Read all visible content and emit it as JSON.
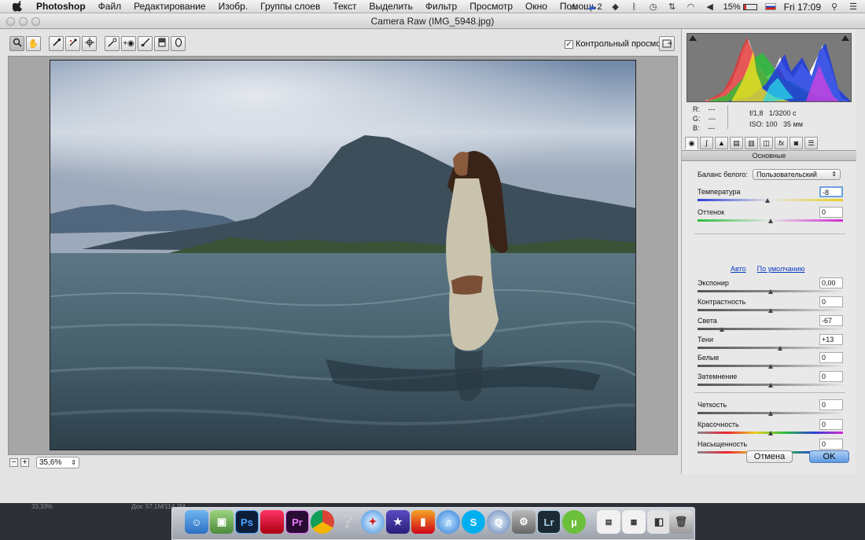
{
  "menubar": {
    "app": "Photoshop",
    "items": [
      "Файл",
      "Редактирование",
      "Изобр.",
      "Группы слоев",
      "Текст",
      "Выделить",
      "Фильтр",
      "Просмотр",
      "Окно",
      "Помощь"
    ],
    "cc_count": "2",
    "battery": "15%",
    "clock": "Fri 17:09"
  },
  "window": {
    "title": "Camera Raw (IMG_5948.jpg)"
  },
  "toolbar": {
    "tools": [
      "zoom-tool",
      "hand-tool",
      "white-balance-tool",
      "color-sampler-tool",
      "target-adjustment-tool",
      "crop-tool",
      "straighten-tool",
      "spot-removal-tool",
      "red-eye-tool",
      "adjustment-brush-tool",
      "graduated-filter-tool",
      "radial-filter-tool"
    ],
    "preview_label": "Контрольный просмотр",
    "preview_checked": true
  },
  "zoom": {
    "value": "35,6%"
  },
  "info": {
    "r_label": "R:",
    "r_value": "---",
    "g_label": "G:",
    "g_value": "---",
    "b_label": "B:",
    "b_value": "---",
    "aperture": "f/1,8",
    "shutter": "1/3200 с",
    "iso": "ISO: 100",
    "focal": "35 мм"
  },
  "panel": {
    "section_title": "Основные",
    "wb_label": "Баланс белого:",
    "wb_value": "Пользовательский",
    "auto_link": "Авто",
    "default_link": "По умолчанию",
    "sliders": [
      {
        "key": "temp",
        "label": "Температура",
        "value": "-8",
        "level": 0.48
      },
      {
        "key": "tint",
        "label": "Оттенок",
        "value": "0",
        "level": 0.5
      },
      {
        "key": "exposure",
        "label": "Экспонир",
        "value": "0,00",
        "level": 0.5
      },
      {
        "key": "contrast",
        "label": "Контрастность",
        "value": "0",
        "level": 0.5
      },
      {
        "key": "highlights",
        "label": "Света",
        "value": "-67",
        "level": 0.17
      },
      {
        "key": "shadows",
        "label": "Тени",
        "value": "+13",
        "level": 0.57
      },
      {
        "key": "whites",
        "label": "Белые",
        "value": "0",
        "level": 0.5
      },
      {
        "key": "blacks",
        "label": "Затемнение",
        "value": "0",
        "level": 0.5
      },
      {
        "key": "clarity",
        "label": "Четкость",
        "value": "0",
        "level": 0.5
      },
      {
        "key": "vibrance",
        "label": "Красочность",
        "value": "0",
        "level": 0.5
      },
      {
        "key": "saturation",
        "label": "Насыщенность",
        "value": "0",
        "level": 0.5
      }
    ]
  },
  "buttons": {
    "cancel": "Отмена",
    "ok": "OK"
  },
  "ps_status": {
    "zoom": "33,33%",
    "doc": "Док: 57,1M/114,2M"
  },
  "colors": {
    "accent": "#5d99e2",
    "link": "#0b3cc0",
    "dialog_bg": "#e3e3e3"
  }
}
